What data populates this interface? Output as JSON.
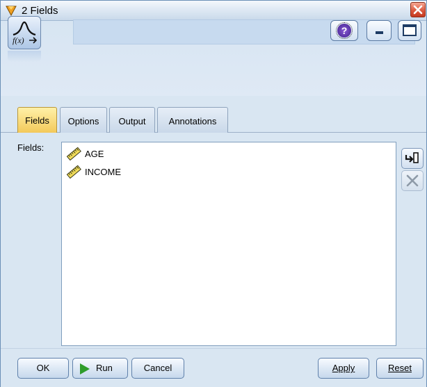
{
  "window": {
    "title": "2 Fields"
  },
  "header": {
    "node_name": "",
    "help_label": "?"
  },
  "tabs": [
    {
      "label": "Fields",
      "active": true
    },
    {
      "label": "Options",
      "active": false
    },
    {
      "label": "Output",
      "active": false
    },
    {
      "label": "Annotations",
      "active": false
    }
  ],
  "fields_panel": {
    "label": "Fields:",
    "items": [
      {
        "name": "AGE",
        "icon": "continuous-ruler-icon"
      },
      {
        "name": "INCOME",
        "icon": "continuous-ruler-icon"
      }
    ],
    "side_buttons": [
      "pick-fields-icon",
      "delete-icon"
    ]
  },
  "buttons": {
    "ok": "OK",
    "run": "Run",
    "cancel": "Cancel",
    "apply": "Apply",
    "reset": "Reset"
  },
  "colors": {
    "window_bg": "#d9e6f2",
    "active_tab": "#f3c95a",
    "close_button": "#d9543a",
    "run_icon": "#2e9c2a"
  }
}
